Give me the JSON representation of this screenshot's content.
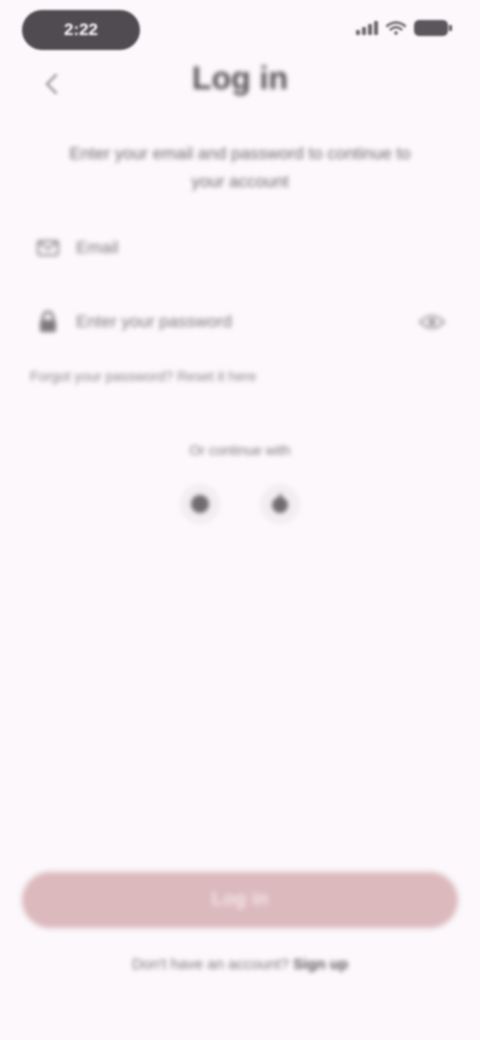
{
  "status_bar": {
    "time": "2:22"
  },
  "header": {
    "title": "Log in",
    "subtitle": "Enter your email and password to continue to your account"
  },
  "form": {
    "email_value": "Email",
    "password_value": "Enter your password",
    "forgot_text": "Forgot your password? Reset it here"
  },
  "social": {
    "label": "Or continue with",
    "buttons": [
      "google-icon",
      "apple-icon"
    ]
  },
  "footer": {
    "primary_button": "Log in",
    "signup_prompt": "Don't have an account? ",
    "signup_link": "Sign up"
  },
  "colors": {
    "background": "#fcf8fb",
    "primary_button": "#dbb9bd"
  }
}
